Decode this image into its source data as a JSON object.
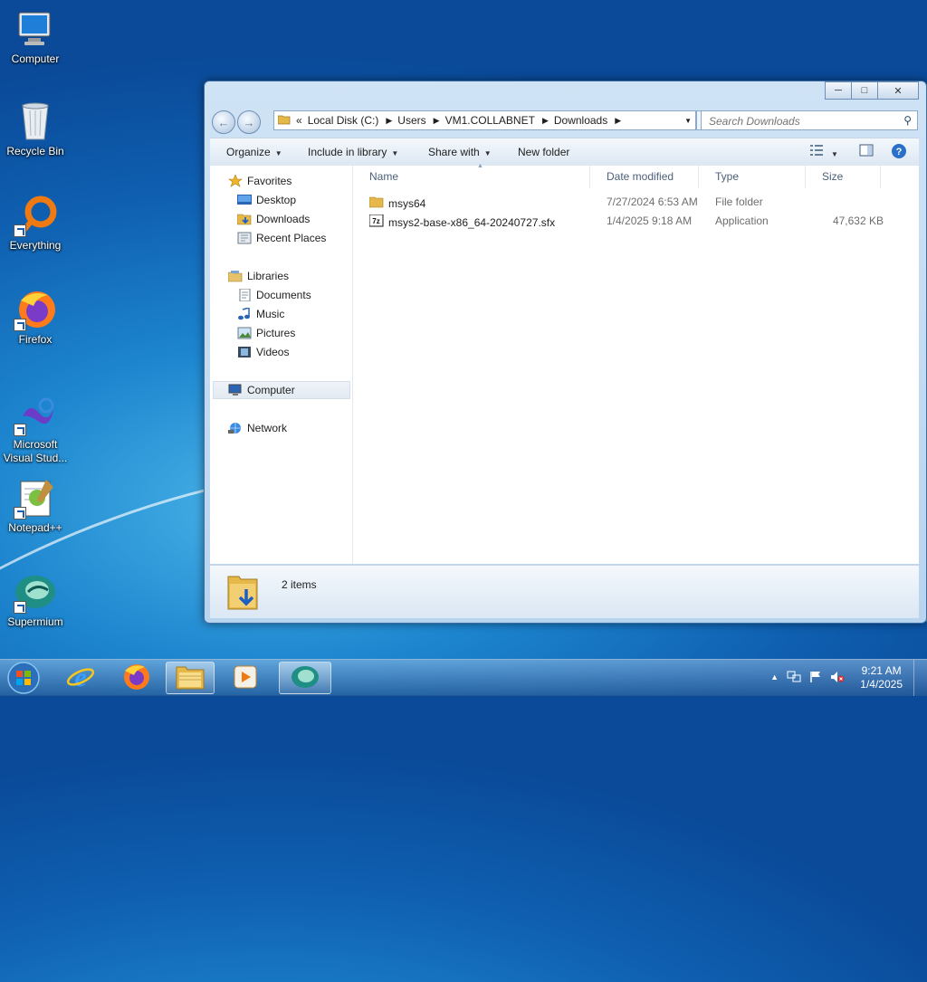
{
  "desktop": {
    "icons": [
      {
        "label": "Computer",
        "icon": "computer-icon"
      },
      {
        "label": "Recycle Bin",
        "icon": "recycle-bin-icon"
      },
      {
        "label": "Everything",
        "icon": "everything-icon"
      },
      {
        "label": "Firefox",
        "icon": "firefox-icon"
      },
      {
        "label": "Microsoft Visual Stud...",
        "icon": "visual-studio-icon"
      },
      {
        "label": "Notepad++",
        "icon": "notepad-plus-plus-icon"
      },
      {
        "label": "Supermium",
        "icon": "supermium-icon"
      }
    ]
  },
  "window": {
    "controls": {
      "minimize": "minimize-icon",
      "maximize": "maximize-icon",
      "close": "close-icon"
    },
    "address": {
      "prefix": "«",
      "segments": [
        "Local Disk (C:)",
        "Users",
        "VM1.COLLABNET",
        "Downloads"
      ]
    },
    "search": {
      "placeholder": "Search Downloads"
    },
    "toolbar": {
      "organize": "Organize",
      "include": "Include in library",
      "share": "Share with",
      "new_folder": "New folder"
    },
    "nav": {
      "favorites": {
        "label": "Favorites",
        "items": [
          "Desktop",
          "Downloads",
          "Recent Places"
        ]
      },
      "libraries": {
        "label": "Libraries",
        "items": [
          "Documents",
          "Music",
          "Pictures",
          "Videos"
        ]
      },
      "computer": "Computer",
      "network": "Network"
    },
    "columns": {
      "name": "Name",
      "date": "Date modified",
      "type": "Type",
      "size": "Size"
    },
    "files": [
      {
        "name": "msys64",
        "date": "7/27/2024 6:53 AM",
        "type": "File folder",
        "size": "",
        "icon": "folder-icon"
      },
      {
        "name": "msys2-base-x86_64-20240727.sfx",
        "date": "1/4/2025 9:18 AM",
        "type": "Application",
        "size": "47,632 KB",
        "icon": "7zip-icon"
      }
    ],
    "details": {
      "count": "2 items"
    }
  },
  "taskbar": {
    "apps": [
      "start-button",
      "internet-explorer-icon",
      "firefox-icon",
      "file-explorer-icon",
      "media-player-icon",
      "supermium-icon"
    ],
    "clock": {
      "time": "9:21 AM",
      "date": "1/4/2025"
    }
  },
  "colors": {
    "accent": "#3a6ea5",
    "desktop": "#1d86cf"
  }
}
